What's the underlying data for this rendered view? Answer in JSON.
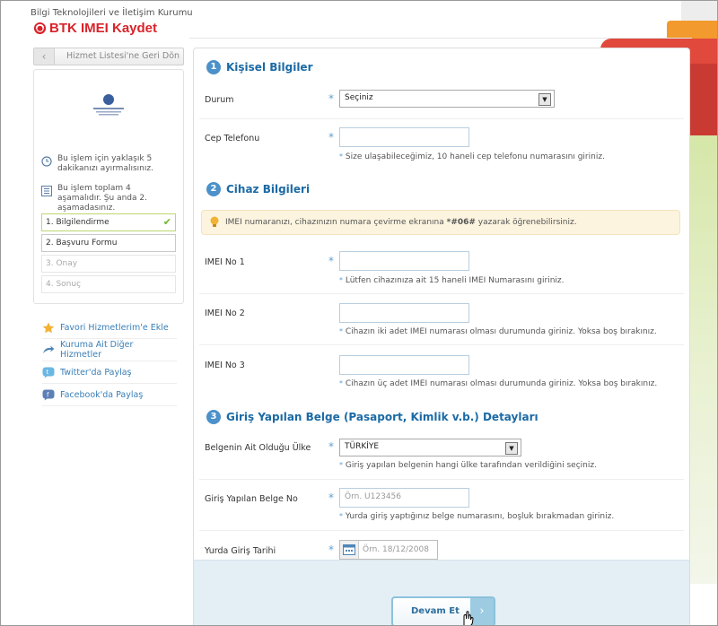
{
  "header": {
    "organization": "Bilgi Teknolojileri ve İletişim Kurumu",
    "brand": "BTK IMEI Kaydet"
  },
  "colors": {
    "brand_red": "#d9232a",
    "section_blue": "#1b6aa5",
    "link_blue": "#3a7fb7",
    "notice_bg": "#fcf4df",
    "footer_bg": "#e3eef5"
  },
  "sidebar": {
    "back_label": "Hizmet Listesi'ne Geri Dön",
    "info": [
      {
        "icon": "clock-icon",
        "text": "Bu işlem için yaklaşık 5 dakikanızı ayırmalısınız."
      },
      {
        "icon": "list-icon",
        "text": "Bu işlem toplam 4 aşamalıdır. Şu anda 2. aşamadasınız."
      }
    ],
    "steps": [
      {
        "label": "1.  Bilgilendirme",
        "state": "done"
      },
      {
        "label": "2.  Başvuru Formu",
        "state": "active"
      },
      {
        "label": "3.  Onay",
        "state": "pending"
      },
      {
        "label": "4.  Sonuç",
        "state": "pending"
      }
    ],
    "links": [
      {
        "icon": "star-icon",
        "label": "Favori Hizmetlerim'e Ekle"
      },
      {
        "icon": "arrow-icon",
        "label": "Kuruma Ait Diğer Hizmetler"
      },
      {
        "icon": "twitter-icon",
        "label": "Twitter'da Paylaş"
      },
      {
        "icon": "facebook-icon",
        "label": "Facebook'da Paylaş"
      }
    ]
  },
  "sections": {
    "s1": {
      "num": "1",
      "title": "Kişisel Bilgiler"
    },
    "s2": {
      "num": "2",
      "title": "Cihaz Bilgileri"
    },
    "s3": {
      "num": "3",
      "title": "Giriş Yapılan Belge (Pasaport, Kimlik v.b.) Detayları"
    }
  },
  "fields": {
    "durum": {
      "label": "Durum",
      "value": "Seçiniz"
    },
    "cep": {
      "label": "Cep Telefonu",
      "hint": "Size ulaşabileceğimiz, 10 haneli cep telefonu numarasını giriniz."
    },
    "notice_pre": "IMEI numaranızı, cihazınızın numara çevirme ekranına ",
    "notice_code": "*#06#",
    "notice_post": " yazarak öğrenebilirsiniz.",
    "imei1": {
      "label": "IMEI No 1",
      "hint": "Lütfen cihazınıza ait 15 haneli IMEI Numarasını giriniz."
    },
    "imei2": {
      "label": "IMEI No 2",
      "hint": "Cihazın iki adet IMEI numarası olması durumunda giriniz. Yoksa boş bırakınız."
    },
    "imei3": {
      "label": "IMEI No 3",
      "hint": "Cihazın üç adet IMEI numarası olması durumunda giriniz. Yoksa boş bırakınız."
    },
    "ulke": {
      "label": "Belgenin Ait Olduğu Ülke",
      "value": "TÜRKİYE",
      "hint": "Giriş yapılan belgenin hangi ülke tarafından verildiğini seçiniz."
    },
    "belge_no": {
      "label": "Giriş Yapılan Belge No",
      "placeholder": "Örn. U123456",
      "hint": "Yurda giriş yaptığınız belge numarasını, boşluk bırakmadan giriniz."
    },
    "tarih": {
      "label": "Yurda Giriş Tarihi",
      "placeholder": "Örn. 18/12/2008"
    }
  },
  "footer": {
    "continue_label": "Devam Et"
  }
}
